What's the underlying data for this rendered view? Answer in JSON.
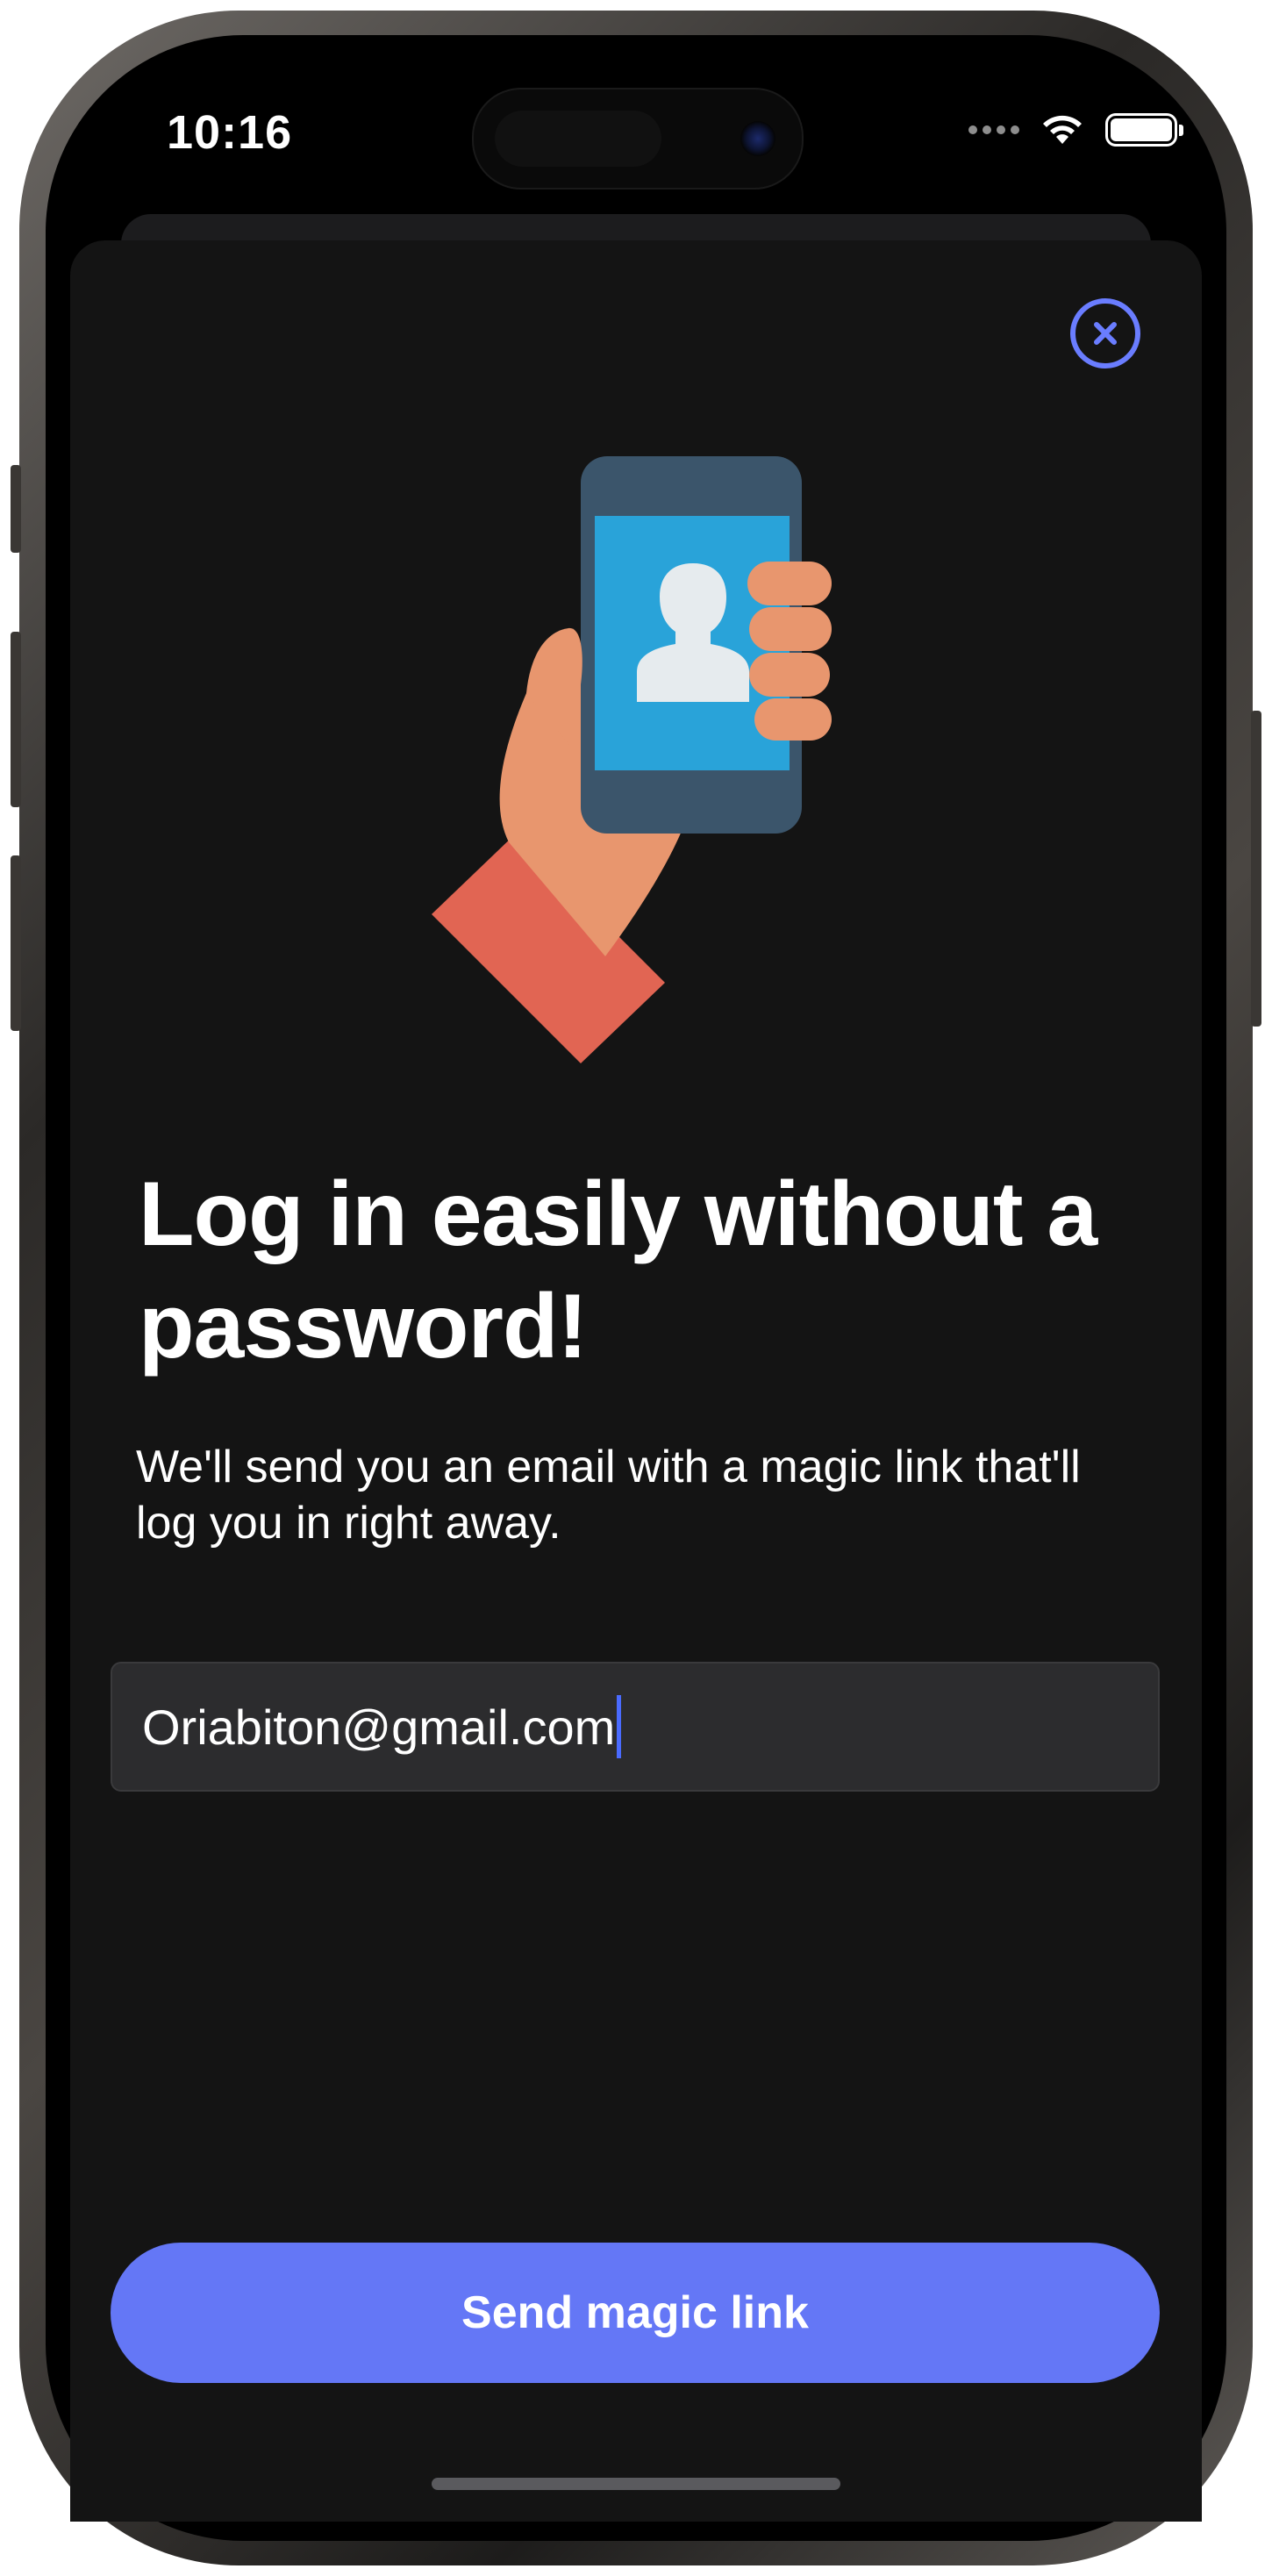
{
  "status_bar": {
    "time": "10:16"
  },
  "icons": {
    "close": "close-circle-icon",
    "wifi": "wifi-icon",
    "battery": "battery-icon",
    "illustration": "hand-holding-phone-icon"
  },
  "content": {
    "headline": "Log in easily without a password!",
    "subtitle": "We'll send you an email with a magic link that'll log you in right away.",
    "email_value": "Oriabiton@gmail.com",
    "send_button_label": "Send magic link"
  },
  "colors": {
    "accent": "#6477f6",
    "close_icon": "#6a7dff",
    "sheet_background": "#141414",
    "field_background": "#2c2c2e"
  }
}
